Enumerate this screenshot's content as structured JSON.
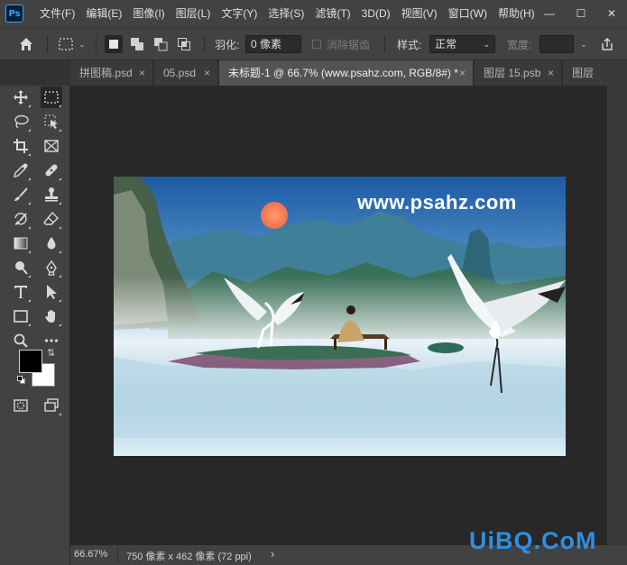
{
  "app": {
    "logo": "Ps"
  },
  "menu": [
    "文件(F)",
    "编辑(E)",
    "图像(I)",
    "图层(L)",
    "文字(Y)",
    "选择(S)",
    "滤镜(T)",
    "3D(D)",
    "视图(V)",
    "窗口(W)",
    "帮助(H)"
  ],
  "window_controls": {
    "minimize": "—",
    "maximize": "☐",
    "close": "✕"
  },
  "options": {
    "feather_label": "羽化:",
    "feather_value": "0 像素",
    "antialias_label": "消除锯齿",
    "style_label": "样式:",
    "style_value": "正常",
    "width_label": "宽度:"
  },
  "tabs": [
    {
      "label": "拼图稿.psd",
      "active": false
    },
    {
      "label": "05.psd",
      "active": false
    },
    {
      "label": "未标题-1 @ 66.7% (www.psahz.com, RGB/8#) *",
      "active": true
    },
    {
      "label": "图层 15.psb",
      "active": false
    },
    {
      "label": "图层",
      "active": false
    }
  ],
  "tools": [
    "move-icon",
    "marquee-icon",
    "lasso-icon",
    "object-select-icon",
    "crop-icon",
    "frame-icon",
    "eyedropper-icon",
    "healing-icon",
    "brush-icon",
    "stamp-icon",
    "history-brush-icon",
    "eraser-icon",
    "gradient-icon",
    "blur-icon",
    "dodge-icon",
    "pen-icon",
    "type-icon",
    "path-select-icon",
    "rectangle-icon",
    "hand-icon",
    "zoom-icon",
    "more-icon"
  ],
  "document": {
    "watermark_text": "www.psahz.com"
  },
  "status": {
    "zoom": "66.67%",
    "doc_info": "750 像素 x 462 像素 (72 ppi)",
    "arrow": "›"
  },
  "site_watermark": "UiBQ.CoM",
  "colors": {
    "foreground": "#000000",
    "background": "#ffffff",
    "ui_dark": "#424242",
    "canvas_bg": "#282828"
  }
}
